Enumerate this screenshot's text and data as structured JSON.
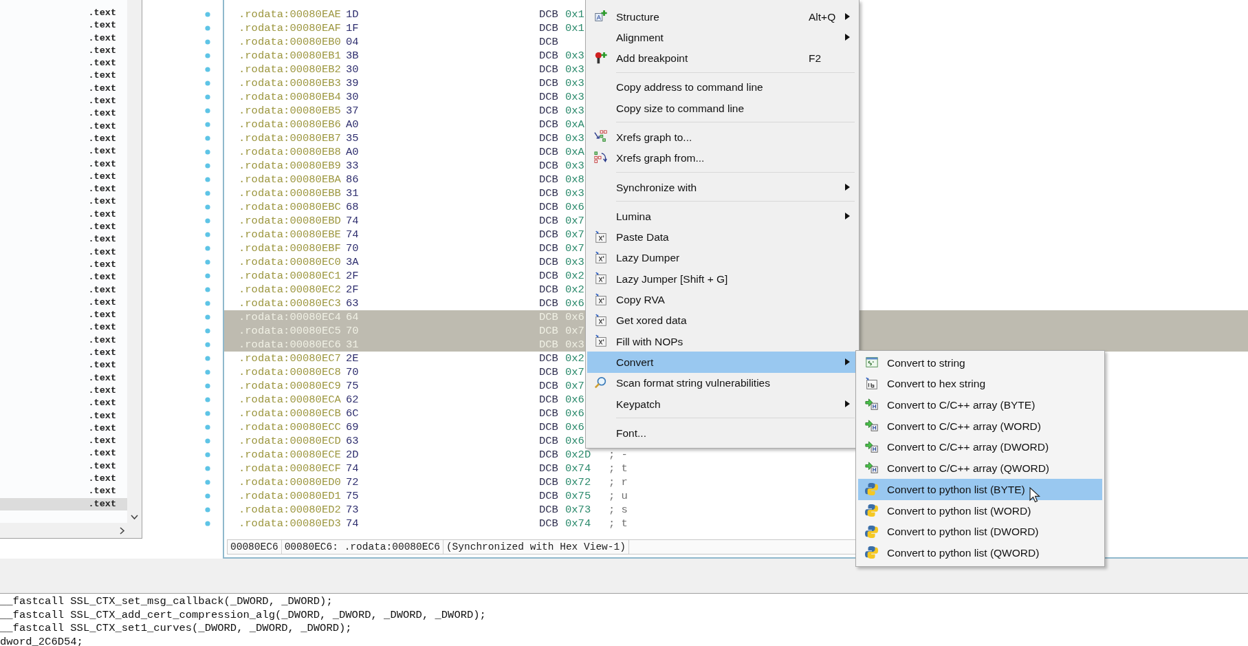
{
  "left_panel": {
    "rows": [
      {
        "text": ".text",
        "selected": false
      },
      {
        "text": ".text",
        "selected": false
      },
      {
        "text": ".text",
        "selected": false
      },
      {
        "text": ".text",
        "selected": false
      },
      {
        "text": ".text",
        "selected": false
      },
      {
        "text": ".text",
        "selected": false
      },
      {
        "text": ".text",
        "selected": false
      },
      {
        "text": ".text",
        "selected": false
      },
      {
        "text": ".text",
        "selected": false
      },
      {
        "text": ".text",
        "selected": false
      },
      {
        "text": ".text",
        "selected": false
      },
      {
        "text": ".text",
        "selected": false
      },
      {
        "text": ".text",
        "selected": false
      },
      {
        "text": ".text",
        "selected": false
      },
      {
        "text": ".text",
        "selected": false
      },
      {
        "text": ".text",
        "selected": false
      },
      {
        "text": ".text",
        "selected": false
      },
      {
        "text": ".text",
        "selected": false
      },
      {
        "text": ".text",
        "selected": false
      },
      {
        "text": ".text",
        "selected": false
      },
      {
        "text": ".text",
        "selected": false
      },
      {
        "text": ".text",
        "selected": false
      },
      {
        "text": ".text",
        "selected": false
      },
      {
        "text": ".text",
        "selected": false
      },
      {
        "text": ".text",
        "selected": false
      },
      {
        "text": ".text",
        "selected": false
      },
      {
        "text": ".text",
        "selected": false
      },
      {
        "text": ".text",
        "selected": false
      },
      {
        "text": ".text",
        "selected": false
      },
      {
        "text": ".text",
        "selected": false
      },
      {
        "text": ".text",
        "selected": false
      },
      {
        "text": ".text",
        "selected": false
      },
      {
        "text": ".text",
        "selected": false
      },
      {
        "text": ".text",
        "selected": false
      },
      {
        "text": ".text",
        "selected": false
      },
      {
        "text": ".text",
        "selected": false
      },
      {
        "text": ".text",
        "selected": false
      },
      {
        "text": ".text",
        "selected": false
      },
      {
        "text": ".text",
        "selected": false
      },
      {
        "text": ".text",
        "selected": true
      }
    ]
  },
  "listing": {
    "rows": [
      {
        "address": ".rodata:00080EAE",
        "byte": "1D",
        "mnemonic": "DCB",
        "operand": "0x1",
        "selected": false
      },
      {
        "address": ".rodata:00080EAF",
        "byte": "1F",
        "mnemonic": "DCB",
        "operand": "0x1",
        "selected": false
      },
      {
        "address": ".rodata:00080EB0",
        "byte": "04",
        "mnemonic": "DCB",
        "selected": false
      },
      {
        "address": ".rodata:00080EB1",
        "byte": "3B",
        "mnemonic": "DCB",
        "operand": "0x3",
        "selected": false
      },
      {
        "address": ".rodata:00080EB2",
        "byte": "30",
        "mnemonic": "DCB",
        "operand": "0x3",
        "selected": false
      },
      {
        "address": ".rodata:00080EB3",
        "byte": "39",
        "mnemonic": "DCB",
        "operand": "0x3",
        "selected": false
      },
      {
        "address": ".rodata:00080EB4",
        "byte": "30",
        "mnemonic": "DCB",
        "operand": "0x3",
        "selected": false
      },
      {
        "address": ".rodata:00080EB5",
        "byte": "37",
        "mnemonic": "DCB",
        "operand": "0x3",
        "selected": false
      },
      {
        "address": ".rodata:00080EB6",
        "byte": "A0",
        "mnemonic": "DCB",
        "operand": "0xA",
        "selected": false
      },
      {
        "address": ".rodata:00080EB7",
        "byte": "35",
        "mnemonic": "DCB",
        "operand": "0x3",
        "selected": false
      },
      {
        "address": ".rodata:00080EB8",
        "byte": "A0",
        "mnemonic": "DCB",
        "operand": "0xA",
        "selected": false
      },
      {
        "address": ".rodata:00080EB9",
        "byte": "33",
        "mnemonic": "DCB",
        "operand": "0x3",
        "selected": false
      },
      {
        "address": ".rodata:00080EBA",
        "byte": "86",
        "mnemonic": "DCB",
        "operand": "0x8",
        "selected": false
      },
      {
        "address": ".rodata:00080EBB",
        "byte": "31",
        "mnemonic": "DCB",
        "operand": "0x3",
        "selected": false
      },
      {
        "address": ".rodata:00080EBC",
        "byte": "68",
        "mnemonic": "DCB",
        "operand": "0x6",
        "selected": false
      },
      {
        "address": ".rodata:00080EBD",
        "byte": "74",
        "mnemonic": "DCB",
        "operand": "0x7",
        "selected": false
      },
      {
        "address": ".rodata:00080EBE",
        "byte": "74",
        "mnemonic": "DCB",
        "operand": "0x7",
        "selected": false
      },
      {
        "address": ".rodata:00080EBF",
        "byte": "70",
        "mnemonic": "DCB",
        "operand": "0x7",
        "selected": false
      },
      {
        "address": ".rodata:00080EC0",
        "byte": "3A",
        "mnemonic": "DCB",
        "operand": "0x3",
        "selected": false
      },
      {
        "address": ".rodata:00080EC1",
        "byte": "2F",
        "mnemonic": "DCB",
        "operand": "0x2",
        "selected": false
      },
      {
        "address": ".rodata:00080EC2",
        "byte": "2F",
        "mnemonic": "DCB",
        "operand": "0x2",
        "selected": false
      },
      {
        "address": ".rodata:00080EC3",
        "byte": "63",
        "mnemonic": "DCB",
        "operand": "0x6",
        "selected": false
      },
      {
        "address": ".rodata:00080EC4",
        "byte": "64",
        "mnemonic": "DCB",
        "operand": "0x6",
        "selected": true
      },
      {
        "address": ".rodata:00080EC5",
        "byte": "70",
        "mnemonic": "DCB",
        "operand": "0x7",
        "selected": true
      },
      {
        "address": ".rodata:00080EC6",
        "byte": "31",
        "mnemonic": "DCB",
        "operand": "0x3",
        "selected": true
      },
      {
        "address": ".rodata:00080EC7",
        "byte": "2E",
        "mnemonic": "DCB",
        "operand": "0x2",
        "selected": false
      },
      {
        "address": ".rodata:00080EC8",
        "byte": "70",
        "mnemonic": "DCB",
        "operand": "0x7",
        "selected": false
      },
      {
        "address": ".rodata:00080EC9",
        "byte": "75",
        "mnemonic": "DCB",
        "operand": "0x7",
        "selected": false
      },
      {
        "address": ".rodata:00080ECA",
        "byte": "62",
        "mnemonic": "DCB",
        "operand": "0x6",
        "selected": false
      },
      {
        "address": ".rodata:00080ECB",
        "byte": "6C",
        "mnemonic": "DCB",
        "operand": "0x6",
        "selected": false
      },
      {
        "address": ".rodata:00080ECC",
        "byte": "69",
        "mnemonic": "DCB",
        "operand": "0x6",
        "selected": false
      },
      {
        "address": ".rodata:00080ECD",
        "byte": "63",
        "mnemonic": "DCB",
        "operand": "0x6",
        "selected": false
      },
      {
        "address": ".rodata:00080ECE",
        "byte": "2D",
        "mnemonic": "DCB",
        "operand": "0x2D",
        "comment": "; -",
        "selected": false
      },
      {
        "address": ".rodata:00080ECF",
        "byte": "74",
        "mnemonic": "DCB",
        "operand": "0x74",
        "comment": "; t",
        "selected": false
      },
      {
        "address": ".rodata:00080ED0",
        "byte": "72",
        "mnemonic": "DCB",
        "operand": "0x72",
        "comment": "; r",
        "selected": false
      },
      {
        "address": ".rodata:00080ED1",
        "byte": "75",
        "mnemonic": "DCB",
        "operand": "0x75",
        "comment": "; u",
        "selected": false
      },
      {
        "address": ".rodata:00080ED2",
        "byte": "73",
        "mnemonic": "DCB",
        "operand": "0x73",
        "comment": "; s",
        "selected": false
      },
      {
        "address": ".rodata:00080ED3",
        "byte": "74",
        "mnemonic": "DCB",
        "operand": "0x74",
        "comment": "; t",
        "selected": false
      }
    ]
  },
  "status_bar": [
    "00080EC6",
    "00080EC6: .rodata:00080EC6",
    "(Synchronized with Hex View-1)"
  ],
  "output": {
    "lines": [
      "__fastcall SSL_CTX_set_msg_callback(_DWORD, _DWORD);",
      "__fastcall SSL_CTX_add_cert_compression_alg(_DWORD, _DWORD, _DWORD, _DWORD);",
      "__fastcall SSL_CTX_set1_curves(_DWORD, _DWORD, _DWORD);",
      "dword_2C6D54;"
    ]
  },
  "context_menu": {
    "items": [
      {
        "kind": "item",
        "label": "Structure",
        "shortcut": "Alt+Q",
        "submenu": true,
        "selected": false
      },
      {
        "kind": "item",
        "label": "Alignment",
        "submenu": true,
        "selected": false
      },
      {
        "kind": "item",
        "label": "Add breakpoint",
        "shortcut": "F2",
        "submenu": false,
        "selected": false
      },
      {
        "kind": "separator"
      },
      {
        "kind": "item",
        "label": "Copy address to command line",
        "submenu": false,
        "selected": false
      },
      {
        "kind": "item",
        "label": "Copy size to command line",
        "submenu": false,
        "selected": false
      },
      {
        "kind": "separator"
      },
      {
        "kind": "item",
        "label": "Xrefs graph to...",
        "submenu": false,
        "selected": false
      },
      {
        "kind": "item",
        "label": "Xrefs graph from...",
        "submenu": false,
        "selected": false
      },
      {
        "kind": "separator"
      },
      {
        "kind": "item",
        "label": "Synchronize with",
        "submenu": true,
        "selected": false
      },
      {
        "kind": "separator"
      },
      {
        "kind": "item",
        "label": "Lumina",
        "submenu": true,
        "selected": false
      },
      {
        "kind": "item",
        "label": "Paste Data",
        "submenu": false,
        "selected": false
      },
      {
        "kind": "item",
        "label": "Lazy Dumper",
        "submenu": false,
        "selected": false
      },
      {
        "kind": "item",
        "label": "Lazy Jumper [Shift + G]",
        "submenu": false,
        "selected": false
      },
      {
        "kind": "item",
        "label": "Copy RVA",
        "submenu": false,
        "selected": false
      },
      {
        "kind": "item",
        "label": "Get xored data",
        "submenu": false,
        "selected": false
      },
      {
        "kind": "item",
        "label": "Fill with NOPs",
        "submenu": false,
        "selected": false
      },
      {
        "kind": "item",
        "label": "Convert",
        "submenu": true,
        "selected": true
      },
      {
        "kind": "item",
        "label": "Scan format string vulnerabilities",
        "submenu": false,
        "selected": false
      },
      {
        "kind": "item",
        "label": "Keypatch",
        "submenu": true,
        "selected": false
      },
      {
        "kind": "separator"
      },
      {
        "kind": "item",
        "label": "Font...",
        "submenu": false,
        "selected": false
      }
    ]
  },
  "submenu": {
    "items": [
      {
        "label": "Convert to string",
        "selected": false
      },
      {
        "label": "Convert to hex string",
        "selected": false
      },
      {
        "label": "Convert to C/C++ array (BYTE)",
        "selected": false
      },
      {
        "label": "Convert to C/C++ array (WORD)",
        "selected": false
      },
      {
        "label": "Convert to C/C++ array (DWORD)",
        "selected": false
      },
      {
        "label": "Convert to C/C++ array (QWORD)",
        "selected": false
      },
      {
        "label": "Convert to python list (BYTE)",
        "selected": true
      },
      {
        "label": "Convert to python list (WORD)",
        "selected": false
      },
      {
        "label": "Convert to python list (DWORD)",
        "selected": false
      },
      {
        "label": "Convert to python list (QWORD)",
        "selected": false
      }
    ]
  }
}
